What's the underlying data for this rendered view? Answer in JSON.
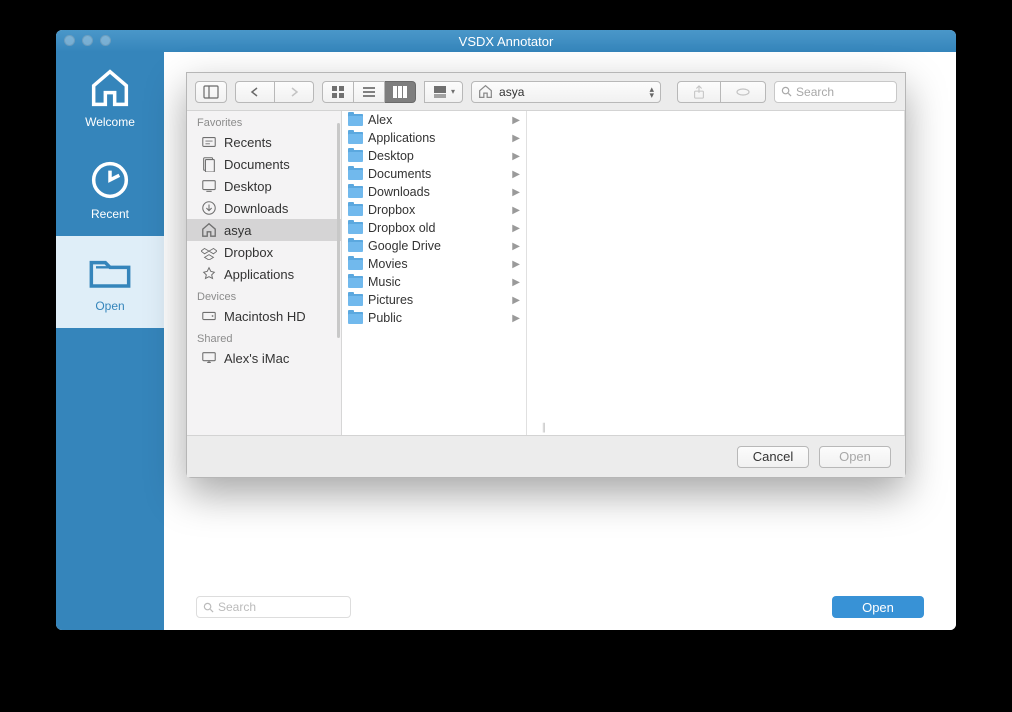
{
  "title": "VSDX Annotator",
  "colors": {
    "accent": "#3585bb",
    "accent_light": "#dfeef8"
  },
  "sidebar": [
    {
      "id": "welcome",
      "label": "Welcome",
      "icon": "home-icon",
      "active": false
    },
    {
      "id": "recent",
      "label": "Recent",
      "icon": "clock-icon",
      "active": false
    },
    {
      "id": "open",
      "label": "Open",
      "icon": "folder-open-icon",
      "active": true
    }
  ],
  "bottom_search_placeholder": "Search",
  "open_button": "Open",
  "dialog": {
    "path_current": "asya",
    "path_icon": "home-icon",
    "search_placeholder": "Search",
    "buttons": {
      "cancel": "Cancel",
      "open": "Open"
    },
    "sidebar": {
      "favorites_label": "Favorites",
      "devices_label": "Devices",
      "shared_label": "Shared",
      "favorites": [
        {
          "label": "Recents",
          "icon": "recents-icon"
        },
        {
          "label": "Documents",
          "icon": "documents-icon"
        },
        {
          "label": "Desktop",
          "icon": "desktop-icon"
        },
        {
          "label": "Downloads",
          "icon": "downloads-icon"
        },
        {
          "label": "asya",
          "icon": "home-icon",
          "selected": true
        },
        {
          "label": "Dropbox",
          "icon": "dropbox-icon"
        },
        {
          "label": "Applications",
          "icon": "applications-icon"
        }
      ],
      "devices": [
        {
          "label": "Macintosh HD",
          "icon": "hdd-icon"
        }
      ],
      "shared": [
        {
          "label": "Alex's iMac",
          "icon": "imac-icon"
        }
      ]
    },
    "column_items": [
      {
        "label": "Alex"
      },
      {
        "label": "Applications"
      },
      {
        "label": "Desktop"
      },
      {
        "label": "Documents"
      },
      {
        "label": "Downloads"
      },
      {
        "label": "Dropbox"
      },
      {
        "label": "Dropbox old"
      },
      {
        "label": "Google Drive"
      },
      {
        "label": "Movies"
      },
      {
        "label": "Music"
      },
      {
        "label": "Pictures"
      },
      {
        "label": "Public"
      }
    ]
  }
}
